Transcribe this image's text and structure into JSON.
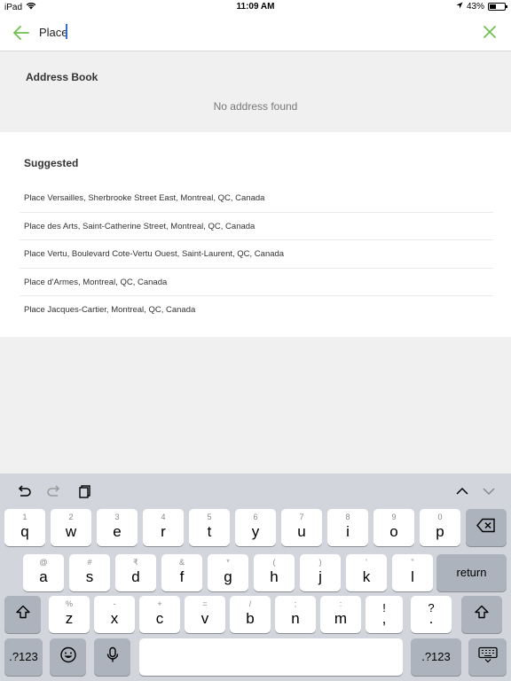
{
  "status_bar": {
    "device": "iPad",
    "time": "11:09 AM",
    "battery": "43%",
    "battery_level": 0.43
  },
  "search": {
    "value": "Place",
    "back_icon": "arrow-left-icon",
    "clear_icon": "close-icon",
    "accent_color": "#6cc24a"
  },
  "address_book": {
    "title": "Address Book",
    "empty_message": "No address found"
  },
  "suggested": {
    "title": "Suggested",
    "items": [
      "Place Versailles, Sherbrooke Street East, Montreal, QC, Canada",
      "Place des Arts, Saint-Catherine Street, Montreal, QC, Canada",
      "Place Vertu, Boulevard Cote-Vertu Ouest, Saint-Laurent, QC, Canada",
      "Place d'Armes, Montreal, QC, Canada",
      "Place Jacques-Cartier, Montreal, QC, Canada"
    ]
  },
  "keyboard": {
    "toolbar_icons": [
      "undo-icon",
      "redo-icon",
      "paste-icon",
      "chevron-up-icon",
      "chevron-down-icon"
    ],
    "row1": [
      {
        "hint": "1",
        "key": "q"
      },
      {
        "hint": "2",
        "key": "w"
      },
      {
        "hint": "3",
        "key": "e"
      },
      {
        "hint": "4",
        "key": "r"
      },
      {
        "hint": "5",
        "key": "t"
      },
      {
        "hint": "6",
        "key": "y"
      },
      {
        "hint": "7",
        "key": "u"
      },
      {
        "hint": "8",
        "key": "i"
      },
      {
        "hint": "9",
        "key": "o"
      },
      {
        "hint": "0",
        "key": "p"
      }
    ],
    "row2": [
      {
        "hint": "@",
        "key": "a"
      },
      {
        "hint": "#",
        "key": "s"
      },
      {
        "hint": "₹",
        "key": "d"
      },
      {
        "hint": "&",
        "key": "f"
      },
      {
        "hint": "*",
        "key": "g"
      },
      {
        "hint": "(",
        "key": "h"
      },
      {
        "hint": ")",
        "key": "j"
      },
      {
        "hint": "'",
        "key": "k"
      },
      {
        "hint": "\"",
        "key": "l"
      }
    ],
    "row3": [
      {
        "hint": "%",
        "key": "z"
      },
      {
        "hint": "-",
        "key": "x"
      },
      {
        "hint": "+",
        "key": "c"
      },
      {
        "hint": "=",
        "key": "v"
      },
      {
        "hint": "/",
        "key": "b"
      },
      {
        "hint": ";",
        "key": "n"
      },
      {
        "hint": ":",
        "key": "m"
      },
      {
        "hint": "!",
        "key": ","
      },
      {
        "hint": "?",
        "key": "."
      }
    ],
    "return_label": "return",
    "numbers_label": ".?123",
    "numbers_label_right": ".?123",
    "emoji_icon": "emoji-icon",
    "mic_icon": "microphone-icon",
    "hide_icon": "keyboard-dismiss-icon"
  }
}
